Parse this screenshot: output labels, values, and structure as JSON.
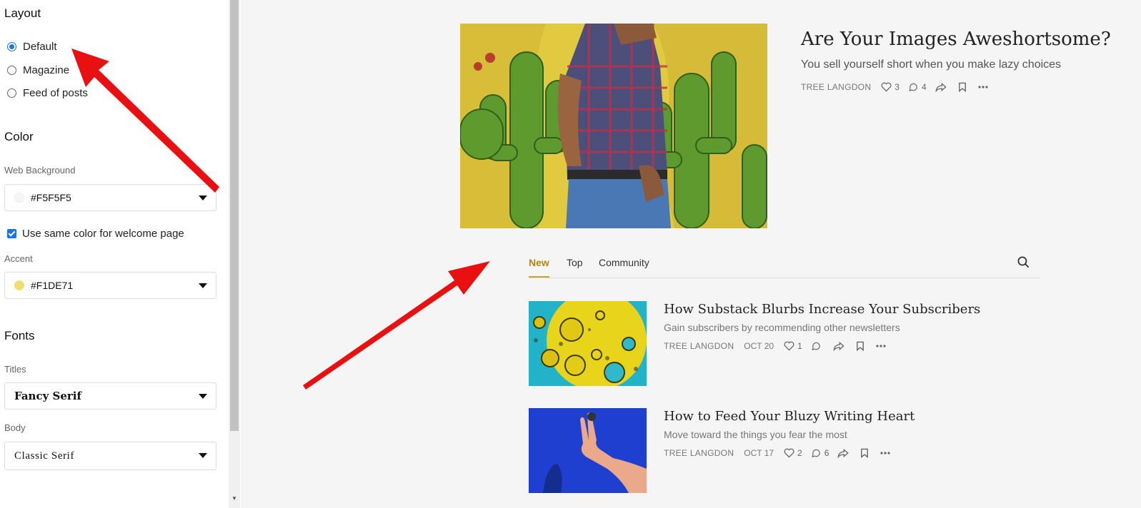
{
  "sidebar": {
    "layout": {
      "title": "Layout",
      "options": [
        "Default",
        "Magazine",
        "Feed of posts"
      ],
      "selected": "Default"
    },
    "color": {
      "title": "Color",
      "web_background_label": "Web Background",
      "web_background_value": "#F5F5F5",
      "web_background_swatch": "#F5F5F5",
      "same_color_label": "Use same color for welcome page",
      "same_color_checked": true,
      "accent_label": "Accent",
      "accent_value": "#F1DE71",
      "accent_swatch": "#F1DE71"
    },
    "fonts": {
      "title": "Fonts",
      "titles_label": "Titles",
      "titles_value": "Fancy Serif",
      "body_label": "Body",
      "body_value": "Classic Serif"
    }
  },
  "hero": {
    "title": "Are Your Images Aweshortsome?",
    "subtitle": "You sell yourself short when you make lazy choices",
    "author": "TREE LANGDON",
    "likes": "3",
    "comments": "4"
  },
  "tabs": {
    "items": [
      "New",
      "Top",
      "Community"
    ],
    "active": "New"
  },
  "posts": [
    {
      "title": "How Substack Blurbs Increase Your Subscribers",
      "subtitle": "Gain subscribers by recommending other newsletters",
      "author": "TREE LANGDON",
      "date": "OCT 20",
      "likes": "1",
      "comments": ""
    },
    {
      "title": "How to Feed Your Bluzy Writing Heart",
      "subtitle": "Move toward the things you fear the most",
      "author": "TREE LANGDON",
      "date": "OCT 17",
      "likes": "2",
      "comments": "6"
    }
  ],
  "colors": {
    "accent_tab": "#b8860b",
    "annotation_arrow": "#e81010",
    "radio_selected": "#1a73e8"
  },
  "icons": [
    "heart-icon",
    "comment-icon",
    "share-icon",
    "bookmark-icon",
    "more-icon",
    "search-icon",
    "caret-down-icon"
  ]
}
